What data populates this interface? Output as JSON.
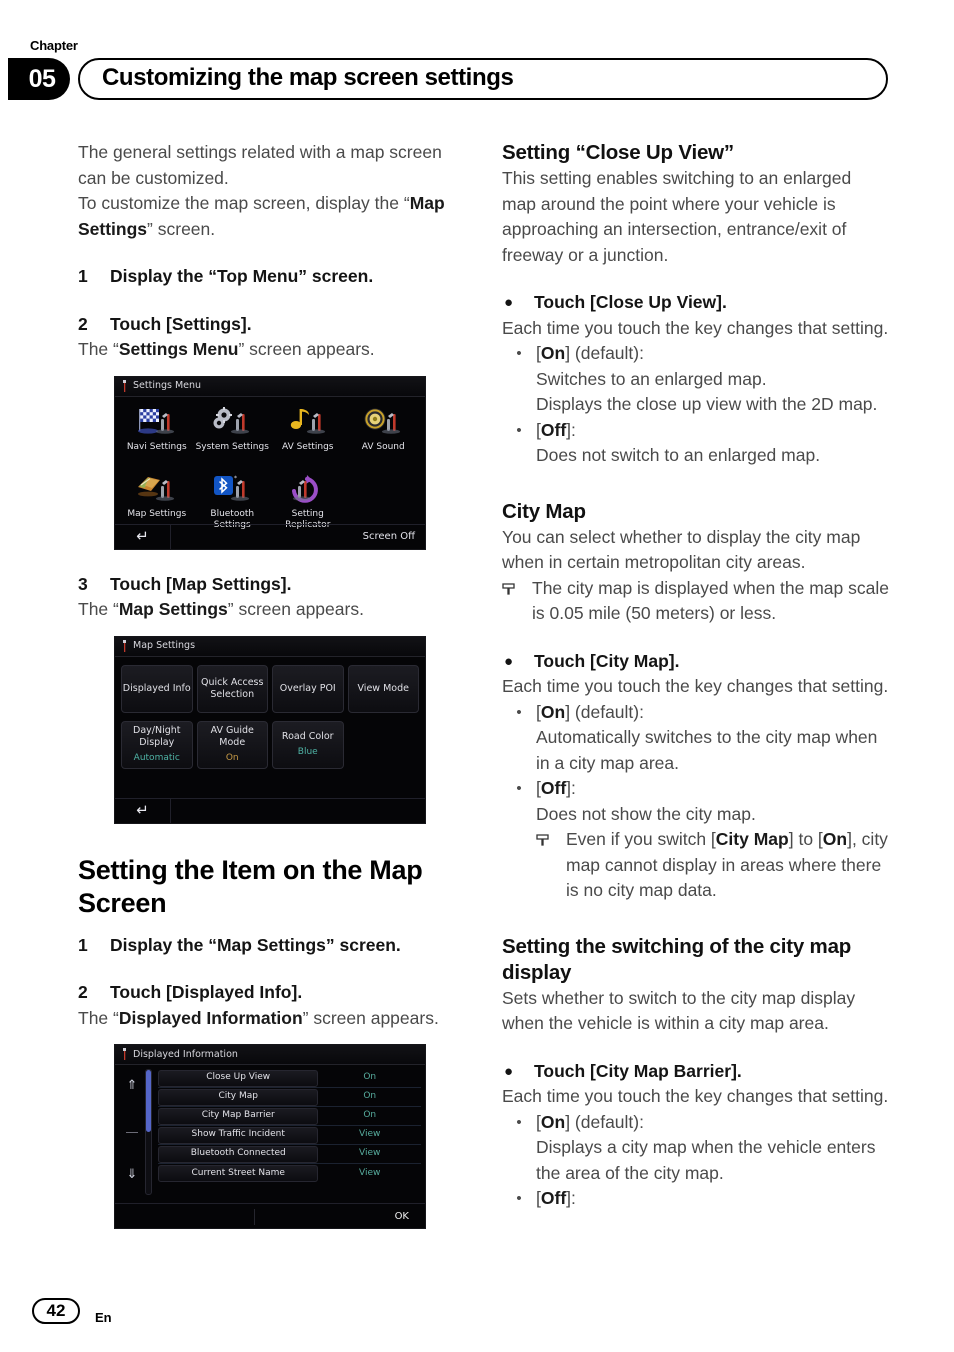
{
  "header": {
    "chapter_word": "Chapter",
    "chapter_number": "05",
    "title": "Customizing the map screen settings"
  },
  "footer": {
    "page_number": "42",
    "language": "En"
  },
  "left_column": {
    "intro_1": "The general settings related with a map screen can be customized.",
    "intro_2_a": "To customize the map screen, display the “",
    "intro_2_b": "Map Settings",
    "intro_2_c": "” screen.",
    "step1_num": "1",
    "step1_text": "Display the “Top Menu” screen.",
    "step2_num": "2",
    "step2_text": "Touch [Settings].",
    "step2_after_a": "The “",
    "step2_after_b": "Settings Menu",
    "step2_after_c": "” screen appears.",
    "step3_num": "3",
    "step3_text": "Touch [Map Settings].",
    "step3_after_a": "The “",
    "step3_after_b": "Map Settings",
    "step3_after_c": "” screen appears.",
    "section_heading": "Setting the Item on the Map Screen",
    "s2_step1_num": "1",
    "s2_step1_text": "Display the “Map Settings” screen.",
    "s2_step2_num": "2",
    "s2_step2_text": "Touch [Displayed Info].",
    "s2_step2_after_a": "The “",
    "s2_step2_after_b": "Displayed Information",
    "s2_step2_after_c": "” screen appears."
  },
  "right_column": {
    "h1": "Setting “Close Up View”",
    "h1_body": "This setting enables switching to an enlarged map around the point where your vehicle is approaching an intersection, entrance/exit of freeway or a junction.",
    "h1_bullet": "Touch [Close Up View].",
    "h1_bullet_after": "Each time you touch the key changes that setting.",
    "h1_opt1_label_a": "[",
    "h1_opt1_label_b": "On",
    "h1_opt1_label_c": "] (default):",
    "h1_opt1_line1": "Switches to an enlarged map.",
    "h1_opt1_line2": "Displays the close up view with the 2D map.",
    "h1_opt2_label_a": "[",
    "h1_opt2_label_b": "Off",
    "h1_opt2_label_c": "]:",
    "h1_opt2_line1": "Does not switch to an enlarged map.",
    "h2": "City Map",
    "h2_body": "You can select whether to display the city map when in certain metropolitan city areas.",
    "h2_note": "The city map is displayed when the map scale is 0.05 mile (50 meters) or less.",
    "h2_bullet": "Touch [City Map].",
    "h2_bullet_after": "Each time you touch the key changes that setting.",
    "h2_opt1_label_a": "[",
    "h2_opt1_label_b": "On",
    "h2_opt1_label_c": "] (default):",
    "h2_opt1_line1": "Automatically switches to the city map when in a city map area.",
    "h2_opt2_label_a": "[",
    "h2_opt2_label_b": "Off",
    "h2_opt2_label_c": "]:",
    "h2_opt2_line1": "Does not show the city map.",
    "h2_opt2_note_a": "Even if you switch [",
    "h2_opt2_note_b": "City Map",
    "h2_opt2_note_c": "] to [",
    "h2_opt2_note_d": "On",
    "h2_opt2_note_e": "], city map cannot display in areas where there is no city map data.",
    "h3": "Setting the switching of the city map display",
    "h3_body": "Sets whether to switch to the city map display when the vehicle is within a city map area.",
    "h3_bullet": "Touch [City Map Barrier].",
    "h3_bullet_after": "Each time you touch the key changes that setting.",
    "h3_opt1_label_a": "[",
    "h3_opt1_label_b": "On",
    "h3_opt1_label_c": "] (default):",
    "h3_opt1_line1": "Displays a city map when the vehicle enters the area of the city map.",
    "h3_opt2_label_a": "[",
    "h3_opt2_label_b": "Off",
    "h3_opt2_label_c": "]:"
  },
  "screenshot_settings_menu": {
    "title": "Settings Menu",
    "items": [
      {
        "label": "Navi Settings",
        "icon": "checkered-flag-wrench-icon"
      },
      {
        "label": "System Settings",
        "icon": "gears-wrench-icon"
      },
      {
        "label": "AV Settings",
        "icon": "music-note-wrench-icon"
      },
      {
        "label": "AV Sound",
        "icon": "speaker-wrench-icon"
      },
      {
        "label": "Map Settings",
        "icon": "map-wrench-icon"
      },
      {
        "label": "Bluetooth Settings",
        "icon": "bluetooth-wrench-icon"
      },
      {
        "label": "Setting Replicator",
        "icon": "replicator-wrench-icon"
      }
    ],
    "back_icon": "back-arrow-icon",
    "screen_off_label": "Screen Off"
  },
  "screenshot_map_settings": {
    "title": "Map Settings",
    "buttons_row1": [
      {
        "label": "Displayed Info",
        "value": ""
      },
      {
        "label": "Quick Access Selection",
        "value": ""
      },
      {
        "label": "Overlay POI",
        "value": ""
      },
      {
        "label": "View Mode",
        "value": ""
      }
    ],
    "buttons_row2": [
      {
        "label": "Day/Night Display",
        "value": "Automatic",
        "value_color": "teal"
      },
      {
        "label": "AV Guide Mode",
        "value": "On",
        "value_color": "amber"
      },
      {
        "label": "Road Color",
        "value": "Blue",
        "value_color": "teal"
      }
    ],
    "back_icon": "back-arrow-icon",
    "colors": {
      "teal": "#4fb3a5",
      "amber": "#c79a46"
    }
  },
  "screenshot_displayed_information": {
    "title": "Displayed Information",
    "scroll_up_icon": "chevron-double-up-icon",
    "scroll_down_icon": "chevron-double-down-icon",
    "rows": [
      {
        "key": "Close Up View",
        "value": "On"
      },
      {
        "key": "City Map",
        "value": "On"
      },
      {
        "key": "City Map Barrier",
        "value": "On"
      },
      {
        "key": "Show Traffic Incident",
        "value": "View"
      },
      {
        "key": "Bluetooth Connected",
        "value": "View"
      },
      {
        "key": "Current Street Name",
        "value": "View"
      }
    ],
    "ok_label": "OK",
    "value_color": "#57ad9e"
  }
}
